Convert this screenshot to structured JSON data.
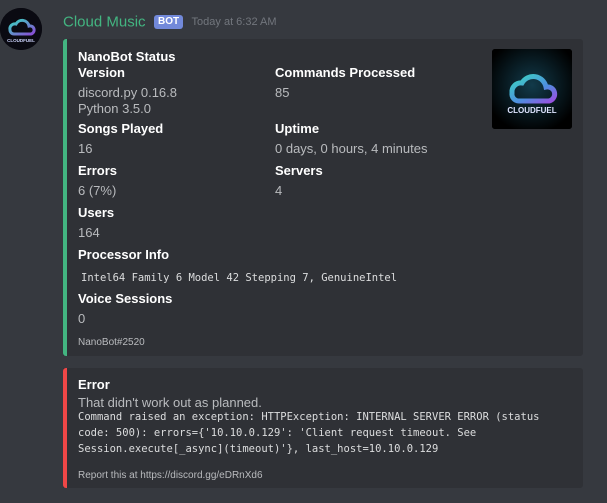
{
  "message": {
    "username": "Cloud Music",
    "bot_tag": "BOT",
    "timestamp": "Today at 6:32 AM",
    "avatar_icon": "cloudfuel-logo",
    "avatar_text": "CLOUDFUEL"
  },
  "status_embed": {
    "title": "NanoBot Status",
    "accent_color": "#43b581",
    "thumbnail_icon": "cloudfuel-logo",
    "thumbnail_text": "CLOUDFUEL",
    "fields": {
      "version": {
        "name": "Version",
        "value_line1": "discord.py 0.16.8",
        "value_line2": "Python 3.5.0"
      },
      "commands": {
        "name": "Commands Processed",
        "value": "85"
      },
      "songs": {
        "name": "Songs Played",
        "value": "16"
      },
      "uptime": {
        "name": "Uptime",
        "value": "0 days, 0 hours, 4 minutes"
      },
      "errors": {
        "name": "Errors",
        "value": "6 (7%)"
      },
      "servers": {
        "name": "Servers",
        "value": "4"
      },
      "users": {
        "name": "Users",
        "value": "164"
      },
      "processor": {
        "name": "Processor Info",
        "value": "Intel64 Family 6 Model 42 Stepping 7, GenuineIntel"
      },
      "voice": {
        "name": "Voice Sessions",
        "value": "0"
      }
    },
    "footer": "NanoBot#2520"
  },
  "error_embed": {
    "title": "Error",
    "accent_color": "#f04747",
    "description": "That didn't work out as planned.",
    "code": "Command raised an exception: HTTPException: INTERNAL SERVER ERROR (status code: 500): errors={'10.10.0.129': 'Client request timeout. See Session.execute[_async](timeout)'}, last_host=10.10.0.129",
    "footer": "Report this at https://discord.gg/eDRnXd6"
  }
}
